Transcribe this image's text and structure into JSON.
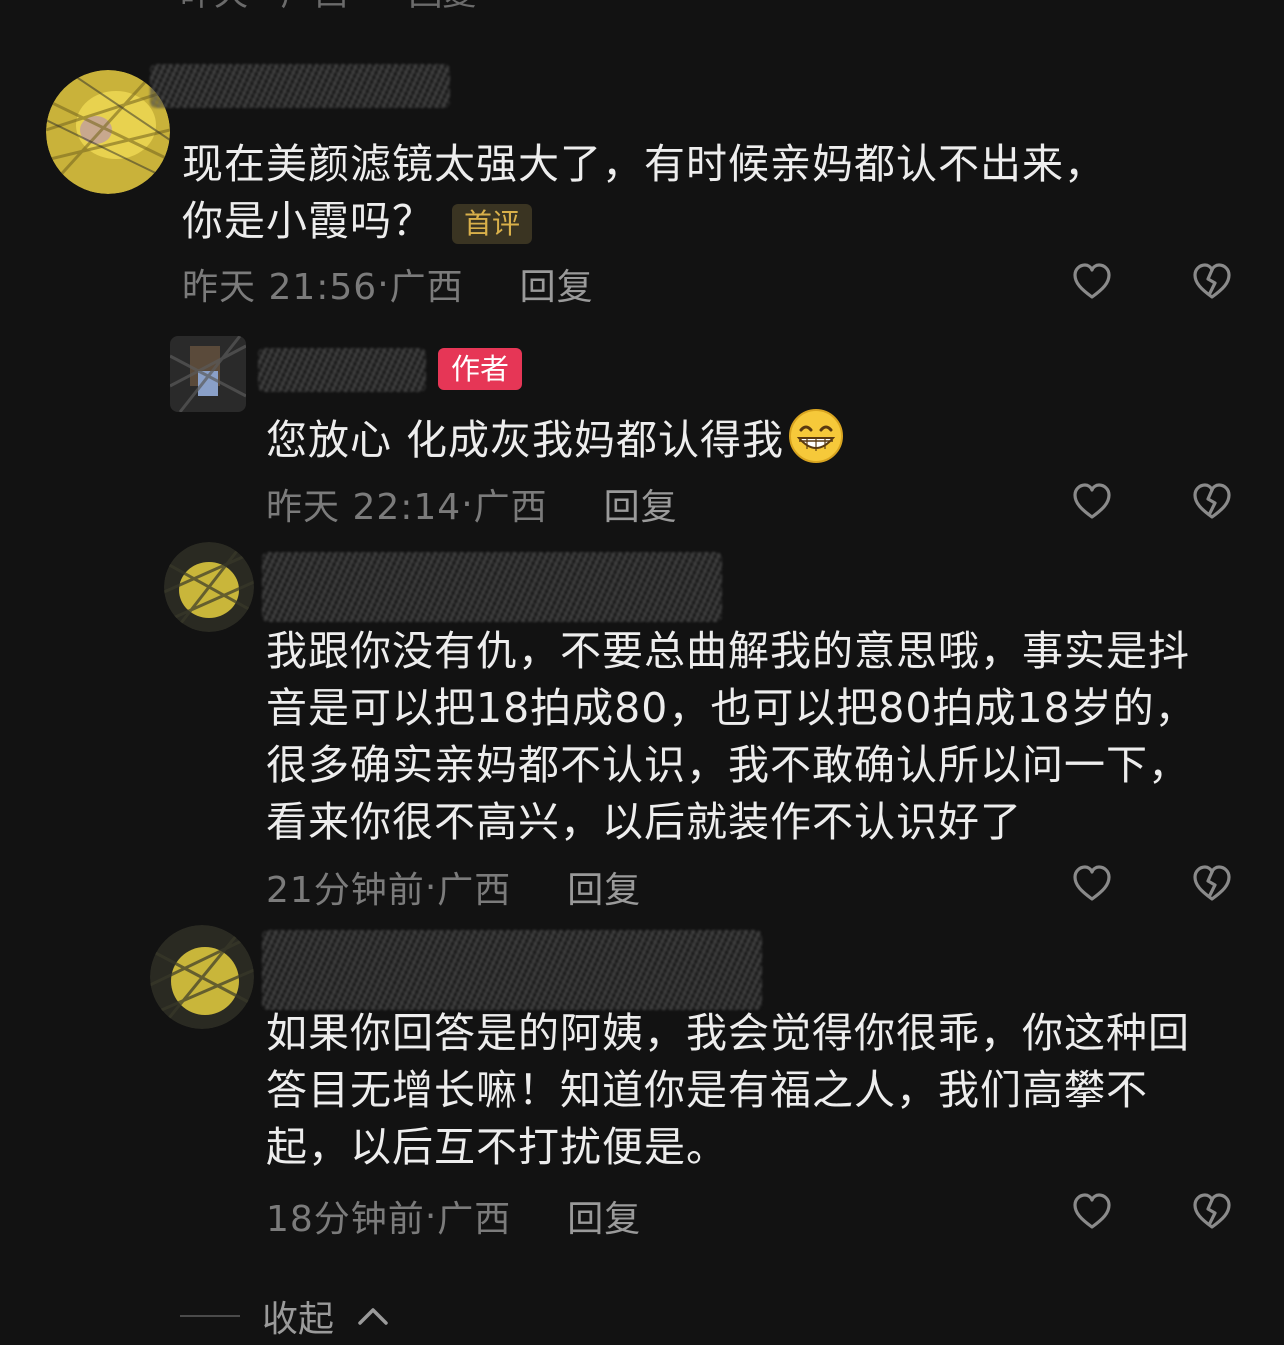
{
  "top_cutoff": {
    "meta_text": "昨天 · 广西",
    "reply_label": "回复"
  },
  "comments": [
    {
      "content": "现在美颜滤镜太强大了，有时候亲妈都认不出来，你是小霞吗？",
      "badge": "首评",
      "time": "昨天 21:56",
      "location": "广西",
      "reply_label": "回复"
    },
    {
      "badge": "作者",
      "content": "您放心 化成灰我妈都认得我",
      "emoji": "grin-emoji",
      "time": "昨天 22:14",
      "location": "广西",
      "reply_label": "回复"
    },
    {
      "content": "我跟你没有仇，不要总曲解我的意思哦，事实是抖音是可以把18拍成80，也可以把80拍成18岁的，很多确实亲妈都不认识，我不敢确认所以问一下，看来你很不高兴，以后就装作不认识好了",
      "time": "21分钟前",
      "location": "广西",
      "reply_label": "回复"
    },
    {
      "content": "如果你回答是的阿姨，我会觉得你很乖，你这种回答目无增长嘛！知道你是有福之人，我们高攀不起，以后互不打扰便是。",
      "time": "18分钟前",
      "location": "广西",
      "reply_label": "回复"
    }
  ],
  "footer": {
    "collapse_label": "收起"
  },
  "icons": {
    "like": "heart-outline-icon",
    "dislike": "broken-heart-icon",
    "collapse": "chevron-up-icon"
  },
  "colors": {
    "background": "#121212",
    "text": "#ededed",
    "meta": "#7b7b7b",
    "author_badge": "#e63656",
    "first_badge_text": "#d9b04a"
  }
}
